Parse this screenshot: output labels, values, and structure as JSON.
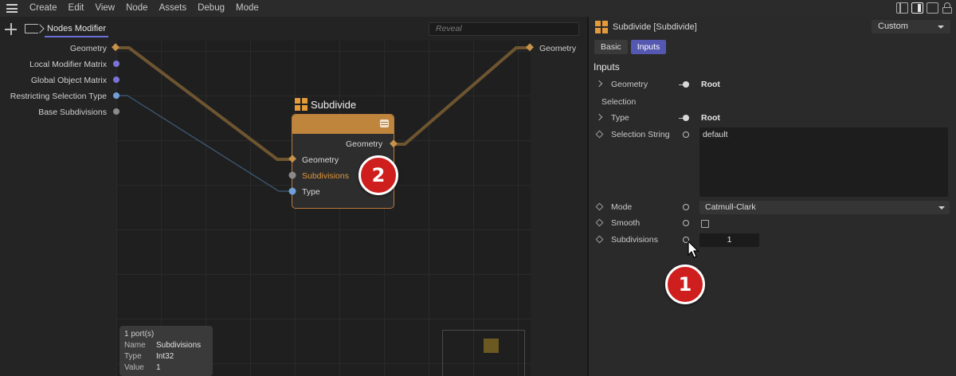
{
  "menu": [
    "Create",
    "Edit",
    "View",
    "Node",
    "Assets",
    "Debug",
    "Mode"
  ],
  "toolbar": {
    "tab_label": "Nodes Modifier",
    "reveal_placeholder": "Reveal"
  },
  "inputs_ports": [
    "Geometry",
    "Local Modifier Matrix",
    "Global Object Matrix",
    "Restricting Selection Type",
    "Base Subdivisions"
  ],
  "output_port": "Geometry",
  "node": {
    "title": "Subdivide",
    "output": "Geometry",
    "inputs": [
      "Geometry",
      "Subdivisions",
      "Type"
    ]
  },
  "tooltip": {
    "count": "1 port(s)",
    "rows": [
      {
        "k": "Name",
        "v": "Subdivisions"
      },
      {
        "k": "Type",
        "v": "Int32"
      },
      {
        "k": "Value",
        "v": "1"
      }
    ]
  },
  "badges": {
    "one": "1",
    "two": "2"
  },
  "attr": {
    "title": "Subdivide [Subdivide]",
    "preset": "Custom",
    "tabs": [
      "Basic",
      "Inputs"
    ],
    "active_tab": "Inputs",
    "section": "Inputs",
    "geometry_label": "Geometry",
    "geometry_value": "Root",
    "selection_label": "Selection",
    "type_label": "Type",
    "type_value": "Root",
    "selection_string_label": "Selection String",
    "selection_string_value": "default",
    "mode_label": "Mode",
    "mode_value": "Catmull-Clark",
    "smooth_label": "Smooth",
    "subdivisions_label": "Subdivisions",
    "subdivisions_value": "1"
  },
  "colors": {
    "accent": "#5558b0",
    "node_header": "#c0853d",
    "port_purple": "#7b73d6",
    "port_blue": "#6fa0d8",
    "port_gold": "#c7924a",
    "badge_red": "#cf1e1e"
  }
}
